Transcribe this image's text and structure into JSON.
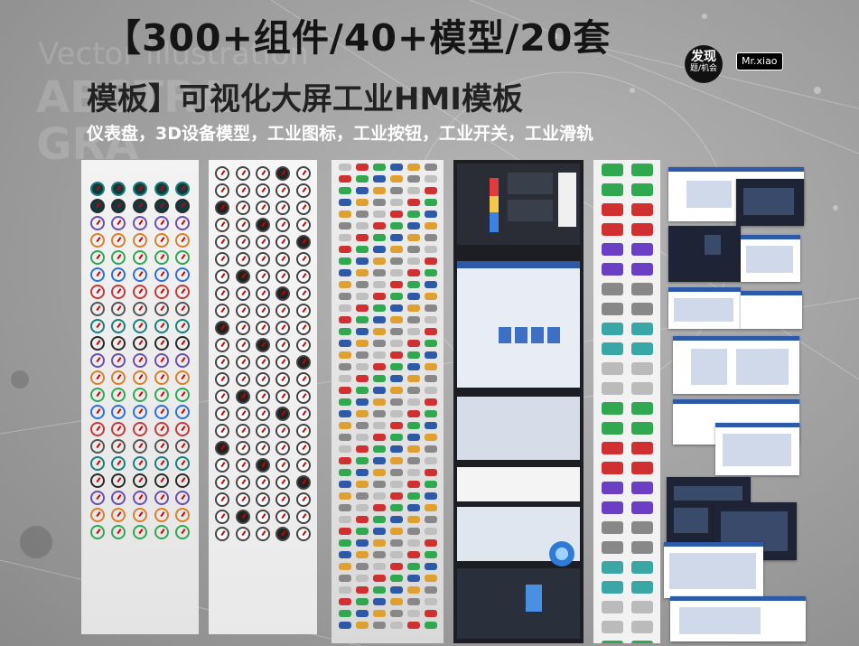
{
  "header": {
    "title_line1": "【300+组件/40+模型/20套",
    "title_line2": "模板】可视化大屏工业HMI模板",
    "subtitle": "仪表盘，3D设备模型，工业图标，工业按钮，工业开关，工业滑轨"
  },
  "background_text": {
    "line1": "Vector illustration",
    "line2": "ABSTRA",
    "line3": "GRA"
  },
  "logo": {
    "line1": "发现",
    "line2": "题/机会"
  },
  "badge": {
    "label": "Mr.xiao"
  },
  "panels": [
    {
      "name": "gauges-sheet"
    },
    {
      "name": "meters-sheet"
    },
    {
      "name": "buttons-switches-sheet"
    },
    {
      "name": "dashboard-ui-sheet"
    },
    {
      "name": "3d-equipment-sheet"
    },
    {
      "name": "hmi-template-screens"
    }
  ],
  "colors": {
    "title_dark": "#151515",
    "subtitle_white": "#ffffff",
    "dark_panel": "#1c1e24",
    "accent_blue": "#2d5aa8",
    "accent_green": "#2fa84f",
    "accent_red": "#d03030"
  }
}
